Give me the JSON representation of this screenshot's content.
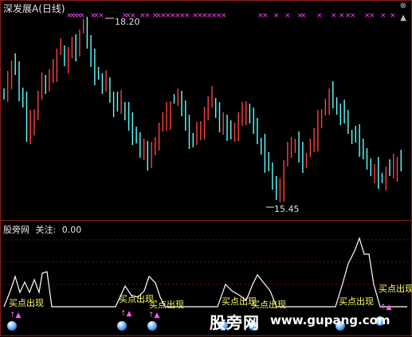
{
  "main": {
    "title": "深发展A(日线)",
    "high_label": "18.20",
    "low_label": "15.45"
  },
  "sub": {
    "indicator_name": "股旁网",
    "focus_label": "关注:",
    "focus_value": "0.00",
    "signal_text": "买点出现",
    "arrow_glyph": "↑▲"
  },
  "watermark": {
    "site_cn": "股旁网",
    "site_url": "www.gupang.com"
  },
  "colors": {
    "up": "#ff4040",
    "down": "#60ffff",
    "cross": "#ff44ff",
    "signal_line": "#ffffff",
    "signal_text": "#ffff60",
    "frame": "#8a1b1b"
  }
}
